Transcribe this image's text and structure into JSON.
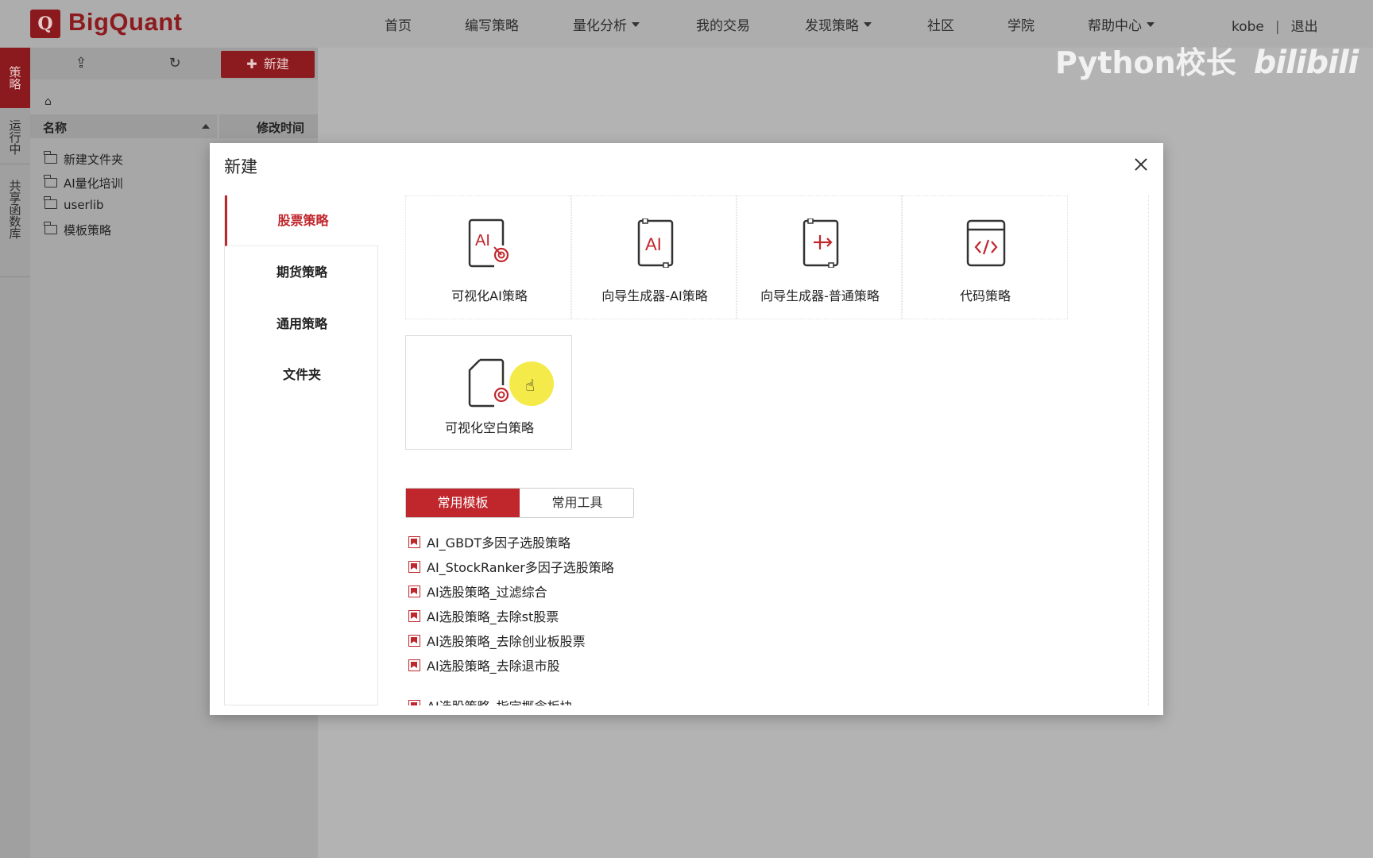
{
  "app": {
    "logo_letter": "Q",
    "name": "BigQuant"
  },
  "nav": {
    "items": [
      {
        "label": "首页"
      },
      {
        "label": "编写策略"
      },
      {
        "label": "量化分析"
      },
      {
        "label": "我的交易"
      },
      {
        "label": "发现策略"
      },
      {
        "label": "社区"
      },
      {
        "label": "学院"
      },
      {
        "label": "帮助中心"
      }
    ],
    "user": "kobe",
    "separator": "|",
    "logout": "退出"
  },
  "watermark": {
    "channel": "Python校长",
    "site": "bilibili"
  },
  "sidebar": {
    "tabs": [
      {
        "label": "策略",
        "active": true
      },
      {
        "label": "运行中",
        "active": false
      },
      {
        "label": "共享函数库",
        "active": false
      }
    ]
  },
  "file_panel": {
    "new_button": "新建",
    "columns": {
      "name": "名称",
      "modified": "修改时间"
    },
    "items": [
      {
        "name": "新建文件夹"
      },
      {
        "name": "AI量化培训"
      },
      {
        "name": "userlib"
      },
      {
        "name": "模板策略"
      }
    ]
  },
  "modal": {
    "title": "新建",
    "categories": [
      {
        "label": "股票策略",
        "active": true
      },
      {
        "label": "期货策略",
        "active": false
      },
      {
        "label": "通用策略",
        "active": false
      },
      {
        "label": "文件夹",
        "active": false
      }
    ],
    "cards": [
      {
        "label": "可视化AI策略",
        "icon": "ai-visual-icon"
      },
      {
        "label": "向导生成器-AI策略",
        "icon": "ai-wizard-icon"
      },
      {
        "label": "向导生成器-普通策略",
        "icon": "wizard-icon"
      },
      {
        "label": "代码策略",
        "icon": "code-icon"
      },
      {
        "label": "可视化空白策略",
        "icon": "blank-visual-icon"
      }
    ],
    "tabs": [
      {
        "label": "常用模板",
        "active": true
      },
      {
        "label": "常用工具",
        "active": false
      }
    ],
    "templates": [
      "AI_GBDT多因子选股策略",
      "AI_StockRanker多因子选股策略",
      "AI选股策略_过滤综合",
      "AI选股策略_去除st股票",
      "AI选股策略_去除创业板股票",
      "AI选股策略_去除退市股",
      "AI选股策略_指定概念板块"
    ]
  },
  "colors": {
    "brand_red": "#c0272d",
    "dimmed_red": "#8c1b1f",
    "overlay_gray": "#b3b3b3",
    "highlight_yellow": "#f3e83a"
  }
}
